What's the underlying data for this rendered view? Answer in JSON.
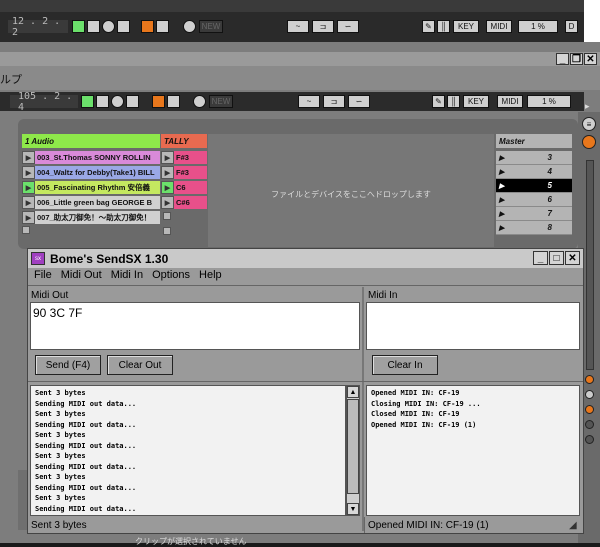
{
  "live_top": {
    "position": "12 .  2 .  2",
    "key_label": "KEY",
    "midi_label": "MIDI",
    "percent": "1 %",
    "d_label": "D",
    "new_label": "NEW"
  },
  "live_main": {
    "menu_fragment": "ルプ",
    "position": "105 .  2 .  4",
    "key_label": "KEY",
    "midi_label": "MIDI",
    "percent": "1 %",
    "new_label": "NEW",
    "drop_hint": "ファイルとデバイスをここへドロップします",
    "no_clip_text": "クリップが選択されていません"
  },
  "session": {
    "track1_name": "1 Audio",
    "track2_name": "TALLY",
    "master_name": "Master",
    "clips": [
      {
        "name": "003_St.Thomas  SONNY ROLLIN",
        "color": "#d98ad9"
      },
      {
        "name": "004_Waltz for Debby(Take1) BILL",
        "color": "#9aa8e6"
      },
      {
        "name": "005_Fascinating Rhythm  安倍義",
        "color": "#c4e860"
      },
      {
        "name": "006_Little green bag  GEORGE B",
        "color": "#d0d0d0"
      },
      {
        "name": "007_助太刀御免！～助太刀御免！",
        "color": "#d0d0d0"
      }
    ],
    "notes": [
      "F#3",
      "F#3",
      "C6",
      "C#6"
    ],
    "scenes": [
      "3",
      "4",
      "5",
      "6",
      "7",
      "8"
    ]
  },
  "bome": {
    "title": "Bome's SendSX 1.30",
    "menu": [
      "File",
      "Midi Out",
      "Midi In",
      "Options",
      "Help"
    ],
    "midi_out_label": "Midi Out",
    "midi_in_label": "Midi In",
    "midi_out_value": "90 3C 7F",
    "send_button": "Send (F4)",
    "clear_out_button": "Clear Out",
    "clear_in_button": "Clear In",
    "out_log": "Sent 3 bytes\nSending MIDI out data...\nSent 3 bytes\nSending MIDI out data...\nSent 3 bytes\nSending MIDI out data...\nSent 3 bytes\nSending MIDI out data...\nSent 3 bytes\nSending MIDI out data...\nSent 3 bytes\nSending MIDI out data...\nSent 3 bytes\nSending MIDI out data...",
    "in_log": "Opened MIDI IN: CF-19\nClosing MIDI IN: CF-19 ...\nClosed MIDI IN: CF-19\nOpened MIDI IN: CF-19 (1)",
    "status_left": "Sent 3 bytes",
    "status_right": "Opened MIDI IN: CF-19 (1)"
  },
  "colors": {
    "audio_header": "#8ee84a",
    "tally_header": "#e86a50",
    "note_clip": "#e8508a",
    "selected_scene": "#000000"
  }
}
